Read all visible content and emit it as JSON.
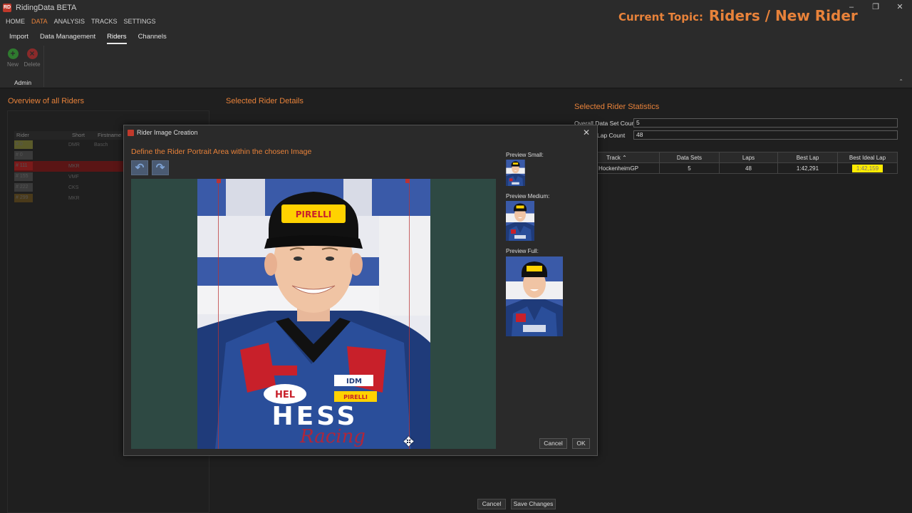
{
  "app": {
    "title": "RidingData BETA",
    "icon_label": "RD",
    "window_controls": [
      "–",
      "❐",
      "✕"
    ]
  },
  "menu": [
    "HOME",
    "DATA",
    "ANALYSIS",
    "TRACKS",
    "SETTINGS"
  ],
  "topic": {
    "label": "Current Topic:",
    "value": "Riders / New Rider"
  },
  "ribbon": {
    "tabs": [
      "Import",
      "Data Management",
      "Riders",
      "Channels"
    ],
    "new_label": "New",
    "delete_label": "Delete",
    "group_label": "Admin",
    "collapse_glyph": "⌃"
  },
  "left": {
    "title": "Overview of all Riders",
    "columns": [
      "Rider",
      "Short",
      "Firstname"
    ],
    "rows": [
      {
        "chip": "# 0",
        "short": "DMR",
        "first": "Basch",
        "color": "#5a5a2a"
      },
      {
        "chip": "# 0",
        "short": "",
        "first": "",
        "color": "#3a3a3a"
      },
      {
        "chip": "# 111",
        "short": "MKR",
        "first": "",
        "color": "#7a1a1a"
      },
      {
        "chip": "# 155",
        "short": "VMF",
        "first": "",
        "color": "#3a3a3a"
      },
      {
        "chip": "# 222",
        "short": "CKS",
        "first": "",
        "color": "#3a3a3a"
      },
      {
        "chip": "# 299",
        "short": "MKR",
        "first": "",
        "color": "#4a3a1a"
      }
    ]
  },
  "middle": {
    "title": "Selected Rider Details"
  },
  "stats": {
    "title": "Selected Rider Statistics",
    "overall_label": "Overall Data Set Count",
    "overall_value": "5",
    "lap_label": "Lap Count",
    "lap_value": "48",
    "columns": [
      "Track",
      "Data Sets",
      "Laps",
      "Best Lap",
      "Best Ideal Lap"
    ],
    "rows": [
      {
        "track": "HockenheimGP",
        "sets": "5",
        "laps": "48",
        "best": "1:42,291",
        "ideal": "1:42,159"
      }
    ]
  },
  "bottom": {
    "cancel": "Cancel",
    "save": "Save Changes"
  },
  "modal": {
    "title": "Rider Image Creation",
    "close": "✕",
    "subtitle": "Define the Rider Portrait Area within the chosen Image",
    "undo_glyph": "↶",
    "redo_glyph": "↷",
    "preview_small": "Preview Small:",
    "preview_medium": "Preview Medium:",
    "preview_full": "Preview Full:",
    "cancel": "Cancel",
    "ok": "OK",
    "move_glyph": "✥"
  },
  "photo_text": {
    "cap_brand": "PIRELLI",
    "chest": "HEL",
    "team": "HESS",
    "script": "Racing",
    "sponsor": "IDM",
    "sponsor2": "PIRELLI"
  }
}
